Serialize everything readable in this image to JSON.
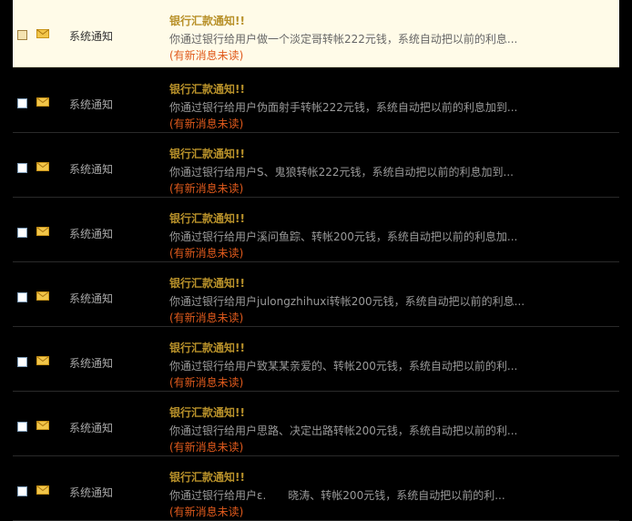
{
  "messages": [
    {
      "sender": "系统通知",
      "title": "银行汇款通知!!",
      "preview": "你通过银行给用户做一个淡定哥转帐222元钱，系统自动把以前的利息...",
      "status": "(有新消息未读)",
      "selected": true
    },
    {
      "sender": "系统通知",
      "title": "银行汇款通知!!",
      "preview": "你通过银行给用户伪面射手转帐222元钱，系统自动把以前的利息加到...",
      "status": "(有新消息未读)",
      "selected": false
    },
    {
      "sender": "系统通知",
      "title": "银行汇款通知!!",
      "preview": "你通过银行给用户S、鬼狼转帐222元钱，系统自动把以前的利息加到...",
      "status": "(有新消息未读)",
      "selected": false
    },
    {
      "sender": "系统通知",
      "title": "银行汇款通知!!",
      "preview": "你通过银行给用户溪问鱼踪、转帐200元钱，系统自动把以前的利息加...",
      "status": "(有新消息未读)",
      "selected": false
    },
    {
      "sender": "系统通知",
      "title": "银行汇款通知!!",
      "preview": "你通过银行给用户julongzhihuxi转帐200元钱，系统自动把以前的利息...",
      "status": "(有新消息未读)",
      "selected": false
    },
    {
      "sender": "系统通知",
      "title": "银行汇款通知!!",
      "preview": "你通过银行给用户致某某亲爱的、转帐200元钱，系统自动把以前的利...",
      "status": "(有新消息未读)",
      "selected": false
    },
    {
      "sender": "系统通知",
      "title": "银行汇款通知!!",
      "preview": "你通过银行给用户思路、决定出路转帐200元钱，系统自动把以前的利...",
      "status": "(有新消息未读)",
      "selected": false
    },
    {
      "sender": "系统通知",
      "title": "银行汇款通知!!",
      "preview": "你通过银行给用户ε.　　晓涛、转帐200元钱，系统自动把以前的利...",
      "status": "(有新消息未读)",
      "selected": false
    }
  ],
  "icons": {
    "mail": "envelope-icon",
    "checkbox": "checkbox"
  },
  "colors": {
    "background": "#000000",
    "title": "#b8912a",
    "unread": "#e05a1c",
    "selected_row": "#fffbe8",
    "envelope": "#f2c64a"
  }
}
